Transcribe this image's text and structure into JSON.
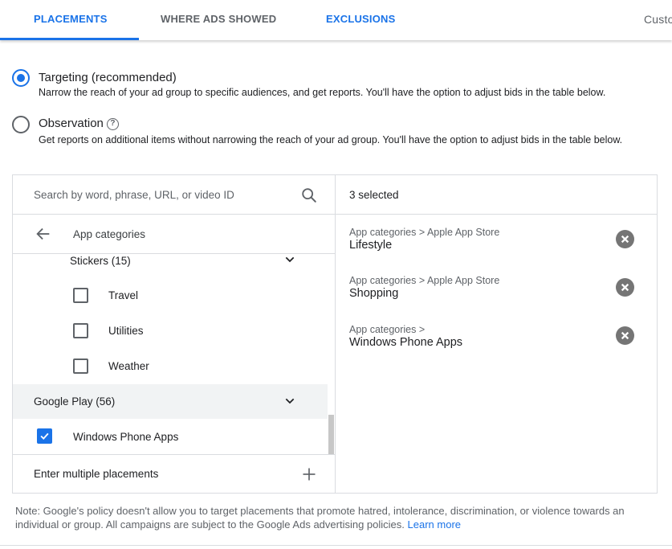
{
  "tabs": [
    {
      "label": "PLACEMENTS"
    },
    {
      "label": "WHERE ADS SHOWED"
    },
    {
      "label": "EXCLUSIONS"
    },
    {
      "label": "Custo"
    }
  ],
  "options": {
    "targeting": {
      "title": "Targeting (recommended)",
      "description": "Narrow the reach of your ad group to specific audiences, and get reports. You'll have the option to adjust bids in the table below."
    },
    "observation": {
      "title": "Observation",
      "description": "Get reports on additional items without narrowing the reach of your ad group. You'll have the option to adjust bids in the table below."
    }
  },
  "browse": {
    "search_placeholder": "Search by word, phrase, URL, or video ID",
    "breadcrumb": "App categories",
    "group_label": "Stickers (15)",
    "items": [
      {
        "label": "Travel"
      },
      {
        "label": "Utilities"
      },
      {
        "label": "Weather"
      }
    ],
    "google_play_label": "Google Play (56)",
    "windows_phone_label": "Windows Phone Apps",
    "enter_multiple_label": "Enter multiple placements"
  },
  "selected": {
    "count_label": "3 selected",
    "items": [
      {
        "crumb": "App categories > Apple App Store",
        "name": "Lifestyle"
      },
      {
        "crumb": "App categories > Apple App Store",
        "name": "Shopping"
      },
      {
        "crumb": "App categories >",
        "name": "Windows Phone Apps"
      }
    ]
  },
  "note": {
    "text": "Note: Google's policy doesn't allow you to target placements that promote hatred, intolerance, discrimination, or violence towards an individual or group. All campaigns are subject to the Google Ads advertising policies.",
    "link": "Learn more"
  },
  "colors": {
    "accent": "#1a73e8",
    "text": "#202124",
    "secondary": "#5f6368",
    "border": "#dadce0"
  }
}
